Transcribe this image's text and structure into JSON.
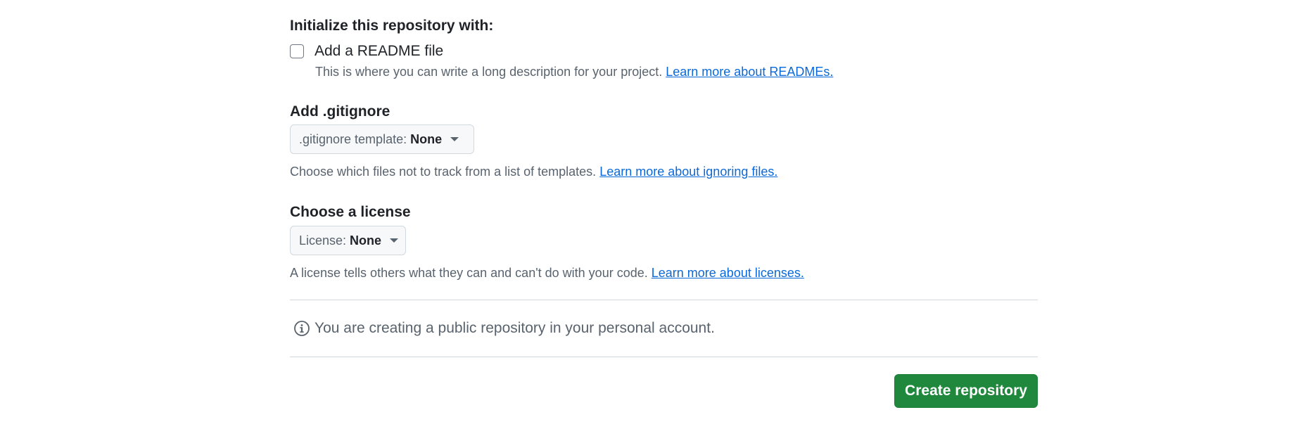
{
  "init": {
    "heading": "Initialize this repository with:",
    "readme": {
      "checked": false,
      "label": "Add a README file",
      "note": "This is where you can write a long description for your project.",
      "link": "Learn more about READMEs."
    }
  },
  "gitignore": {
    "heading": "Add .gitignore",
    "select_prefix": ".gitignore template:",
    "select_value": "None",
    "note": "Choose which files not to track from a list of templates.",
    "link": "Learn more about ignoring files."
  },
  "license": {
    "heading": "Choose a license",
    "select_prefix": "License:",
    "select_value": "None",
    "note": "A license tells others what they can and can't do with your code.",
    "link": "Learn more about licenses."
  },
  "info": {
    "icon": "info-icon",
    "text": "You are creating a public repository in your personal account."
  },
  "actions": {
    "create_label": "Create repository"
  },
  "colors": {
    "primary_button": "#1f883d",
    "link": "#0969da",
    "muted_text": "#59636e",
    "border": "#d1d9e0"
  }
}
